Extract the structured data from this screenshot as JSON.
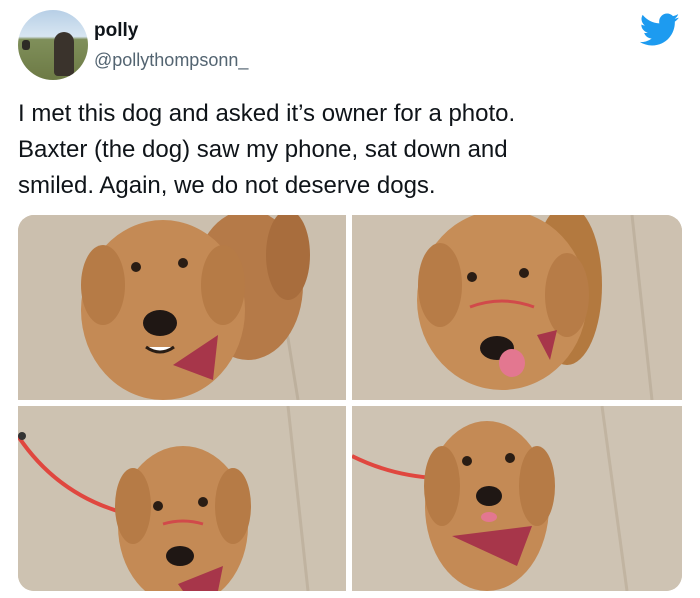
{
  "author": {
    "name": "polly",
    "handle": "@pollythompsonn_",
    "avatar_icon": "profile-photo"
  },
  "brand_icon": "twitter-bird-icon",
  "colors": {
    "twitter_blue": "#1d9bf0",
    "handle_gray": "#536471",
    "text": "#0f1419"
  },
  "tweet": {
    "text_lines": [
      "I met this dog and asked it’s owner for a photo.",
      "Baxter (the dog) saw my phone, sat down and",
      "smiled. Again, we do not deserve dogs."
    ]
  },
  "media": {
    "photo_count": 4
  }
}
